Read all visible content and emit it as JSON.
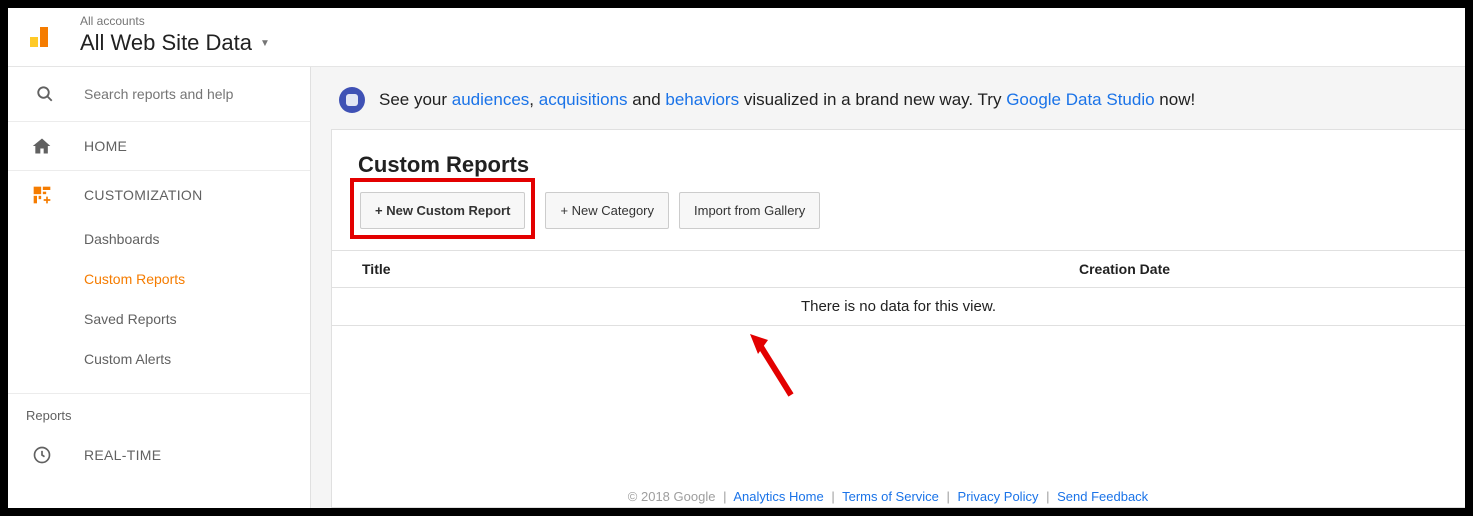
{
  "header": {
    "subtitle": "All accounts",
    "title": "All Web Site Data"
  },
  "sidebar": {
    "search_placeholder": "Search reports and help",
    "home": "HOME",
    "customization": "CUSTOMIZATION",
    "sub_items": [
      "Dashboards",
      "Custom Reports",
      "Saved Reports",
      "Custom Alerts"
    ],
    "reports_label": "Reports",
    "realtime": "REAL-TIME"
  },
  "banner": {
    "pre": "See your ",
    "link1": "audiences",
    "sep1": ", ",
    "link2": "acquisitions",
    "mid": " and ",
    "link3": "behaviors",
    "post1": " visualized in a brand new way. Try ",
    "link4": "Google Data Studio",
    "post2": " now!"
  },
  "panel": {
    "title": "Custom Reports",
    "btn_new_report": "+ New Custom Report",
    "btn_new_category": "+ New Category",
    "btn_import": "Import from Gallery",
    "col_title": "Title",
    "col_date": "Creation Date",
    "empty": "There is no data for this view."
  },
  "footer": {
    "copyright": "© 2018 Google",
    "link1": "Analytics Home",
    "link2": "Terms of Service",
    "link3": "Privacy Policy",
    "link4": "Send Feedback"
  }
}
